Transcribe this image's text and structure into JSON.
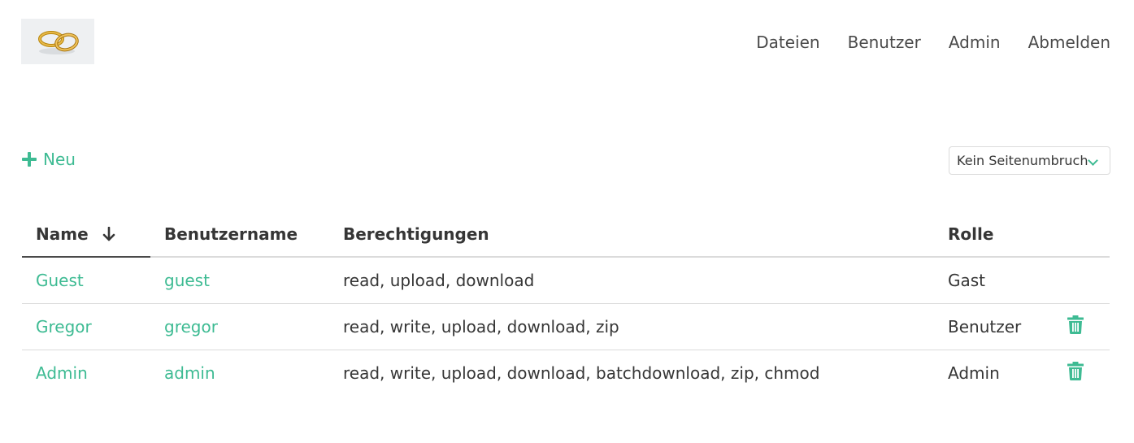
{
  "header": {
    "logo_alt": "rings",
    "nav": [
      {
        "label": "Dateien"
      },
      {
        "label": "Benutzer"
      },
      {
        "label": "Admin"
      },
      {
        "label": "Abmelden"
      }
    ]
  },
  "toolbar": {
    "new_label": "Neu",
    "pagination_select": "Kein Seitenumbruch"
  },
  "table": {
    "columns": [
      "Name",
      "Benutzername",
      "Berechtigungen",
      "Rolle",
      ""
    ],
    "sorted_column": "Name",
    "rows": [
      {
        "name": "Guest",
        "username": "guest",
        "permissions": "read, upload, download",
        "role": "Gast",
        "deletable": false
      },
      {
        "name": "Gregor",
        "username": "gregor",
        "permissions": "read, write, upload, download, zip",
        "role": "Benutzer",
        "deletable": true
      },
      {
        "name": "Admin",
        "username": "admin",
        "permissions": "read, write, upload, download, batchdownload, zip, chmod",
        "role": "Admin",
        "deletable": true
      }
    ]
  },
  "colors": {
    "accent": "#3ebb93",
    "text": "#363636",
    "border": "#dbdbdb"
  }
}
